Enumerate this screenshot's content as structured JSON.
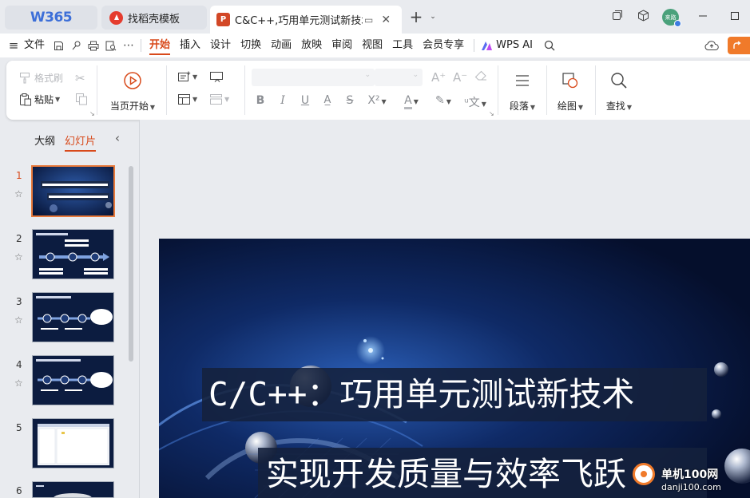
{
  "titlebar": {
    "brand": "W365",
    "tabs": [
      {
        "label": "找稻壳模板",
        "icon": "daoke-logo-icon",
        "color": "#e53c2e"
      },
      {
        "label": "C&C++,巧用单元测试新技术,实",
        "icon": "presentation-file-icon",
        "icon_letter": "P",
        "color": "#d24726"
      }
    ],
    "avatar_text": "来路"
  },
  "menubar": {
    "file": "文件",
    "tabs": [
      "开始",
      "插入",
      "设计",
      "切换",
      "动画",
      "放映",
      "审阅",
      "视图",
      "工具",
      "会员专享"
    ],
    "active_tab": "开始",
    "wps_ai": "WPS AI"
  },
  "ribbon": {
    "format_painter": "格式刷",
    "paste": "粘贴",
    "start_from_current": "当页开始",
    "paragraph": "段落",
    "drawing": "绘图",
    "find": "查找"
  },
  "leftpanel": {
    "tab_outline": "大纲",
    "tab_slides": "幻灯片",
    "active_tab": "幻灯片",
    "slides": [
      {
        "num": "1",
        "selected": true,
        "kind": "title"
      },
      {
        "num": "2",
        "selected": false,
        "kind": "flow"
      },
      {
        "num": "3",
        "selected": false,
        "kind": "flow-bubble"
      },
      {
        "num": "4",
        "selected": false,
        "kind": "flow-bubble"
      },
      {
        "num": "5",
        "selected": false,
        "kind": "screenshot"
      },
      {
        "num": "6",
        "selected": false,
        "kind": "dark"
      }
    ]
  },
  "slide": {
    "title_line1": "C/C++：巧用单元测试新技术",
    "title_line2": "实现开发质量与效率飞跃"
  },
  "watermark": {
    "site": "单机100网",
    "url": "danji100.com"
  },
  "colors": {
    "accent": "#d84a1b",
    "wps_blue": "#3d6fd8",
    "slide_bg": "#071436",
    "selected_thumb_border": "#e8793a"
  }
}
